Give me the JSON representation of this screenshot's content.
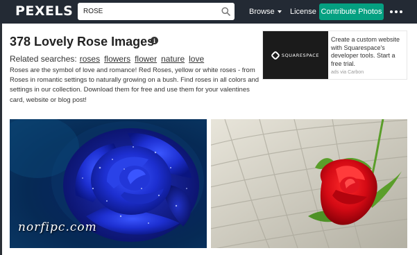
{
  "header": {
    "logo": "PEXELS",
    "search": {
      "value": "ROSE",
      "placeholder": ""
    },
    "nav": {
      "browse": "Browse",
      "license": "License"
    },
    "contribute_label": "Contribute Photos",
    "colors": {
      "bar": "#232a34",
      "accent": "#05a081"
    }
  },
  "main": {
    "title": "378 Lovely Rose Images",
    "related_label": "Related searches:",
    "related": [
      "roses",
      "flowers",
      "flower",
      "nature",
      "love"
    ],
    "description": "Roses are the symbol of love and romance! Red Roses, yellow or white roses - from Roses in romantic settings to naturally growing on a bush. Find roses in all colors and settings in our collection. Download them for free and use them for your valentines card, website or blog post!"
  },
  "ad": {
    "logo_text": "SQUARESPACE",
    "text": "Create a custom website with Squarespace's developer tools. Start a free trial.",
    "via": "ads via Carbon"
  },
  "photos": [
    {
      "name": "blue-rose",
      "icon": "blue-rose-photo"
    },
    {
      "name": "red-rose",
      "icon": "red-rose-photo"
    }
  ],
  "watermark": "norfipc.com"
}
